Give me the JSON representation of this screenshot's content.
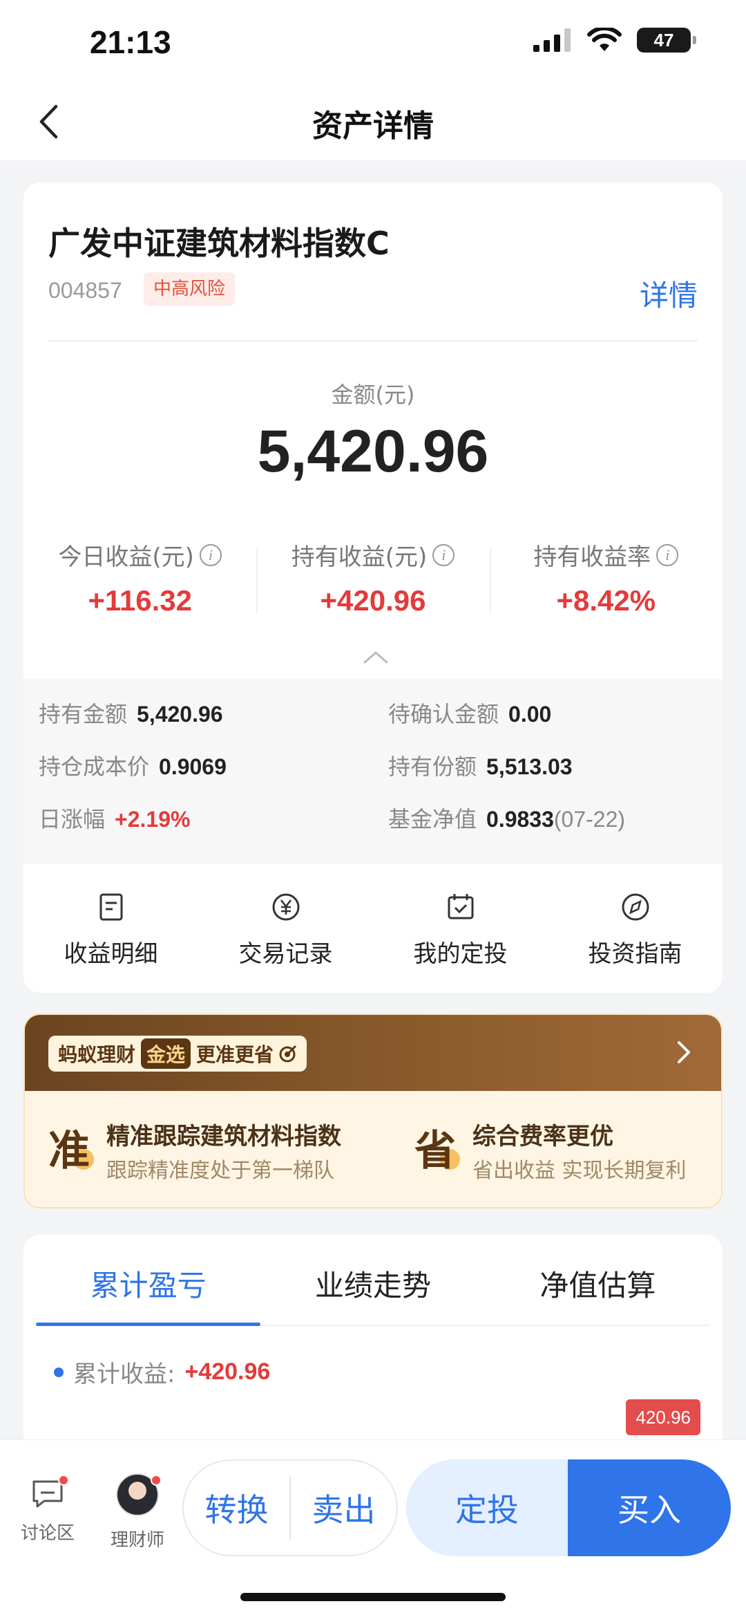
{
  "status_bar": {
    "time": "21:13",
    "battery": "47"
  },
  "nav": {
    "title": "资产详情"
  },
  "fund": {
    "name": "广发中证建筑材料指数C",
    "code": "004857",
    "risk": "中高风险",
    "detail_link": "详情"
  },
  "amount": {
    "label": "金额(元)",
    "value": "5,420.96"
  },
  "stats": [
    {
      "label": "今日收益(元)",
      "value": "+116.32"
    },
    {
      "label": "持有收益(元)",
      "value": "+420.96"
    },
    {
      "label": "持有收益率",
      "value": "+8.42%"
    }
  ],
  "details": {
    "hold_amount": {
      "label": "持有金额",
      "value": "5,420.96"
    },
    "pending_amount": {
      "label": "待确认金额",
      "value": "0.00"
    },
    "cost_price": {
      "label": "持仓成本价",
      "value": "0.9069"
    },
    "shares": {
      "label": "持有份额",
      "value": "5,513.03"
    },
    "daily_change": {
      "label": "日涨幅",
      "value": "+2.19%"
    },
    "nav_value": {
      "label": "基金净值",
      "value": "0.9833",
      "date": "(07-22)"
    }
  },
  "quick_actions": [
    {
      "label": "收益明细",
      "icon": "document-icon"
    },
    {
      "label": "交易记录",
      "icon": "yuan-circle-icon"
    },
    {
      "label": "我的定投",
      "icon": "calendar-check-icon"
    },
    {
      "label": "投资指南",
      "icon": "compass-icon"
    }
  ],
  "promo": {
    "brand": "蚂蚁理财",
    "gold_tag": "金选",
    "slogan": "更准更省",
    "items": [
      {
        "glyph": "准",
        "title": "精准跟踪建筑材料指数",
        "subtitle": "跟踪精准度处于第一梯队"
      },
      {
        "glyph": "省",
        "title": "综合费率更优",
        "subtitle": "省出收益 实现长期复利"
      }
    ]
  },
  "performance": {
    "tabs": [
      "累计盈亏",
      "业绩走势",
      "净值估算"
    ],
    "active_tab": 0,
    "cumulative_label": "累计收益:",
    "cumulative_value": "+420.96",
    "flag_value": "420.96"
  },
  "bottom_bar": {
    "discussion": "讨论区",
    "advisor": "理财师",
    "convert": "转换",
    "sell": "卖出",
    "auto_invest": "定投",
    "buy": "买入"
  },
  "colors": {
    "accent": "#2f74e8",
    "gain": "#e53a3a",
    "promo_brown": "#6b4420"
  }
}
